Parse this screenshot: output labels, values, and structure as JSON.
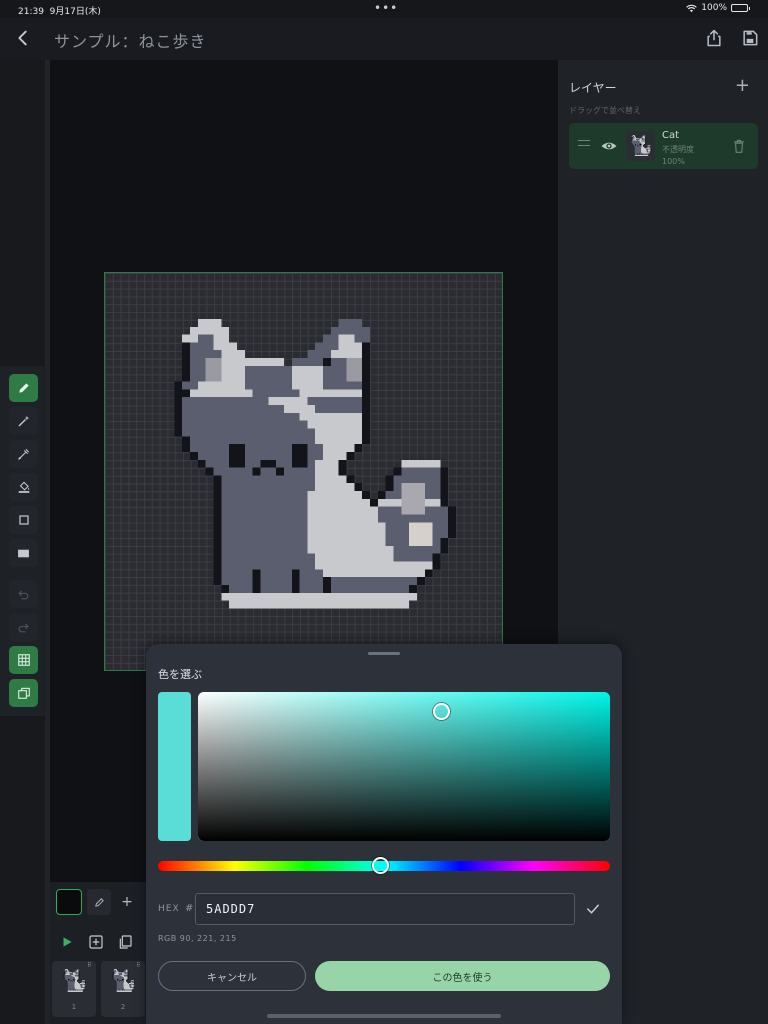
{
  "status": {
    "time": "21:39",
    "date": "9月17日(木)",
    "battery": "100%"
  },
  "header": {
    "title": "サンプル：ねこ歩き"
  },
  "layers_panel": {
    "title": "レイヤー",
    "hint": "ドラッグで並べ替え",
    "layers": [
      {
        "name": "Cat",
        "opacity_label": "不透明度",
        "opacity_value": "100%"
      }
    ]
  },
  "frames": [
    {
      "number": "1"
    },
    {
      "number": "2"
    }
  ],
  "color_picker": {
    "title": "色を選ぶ",
    "hex_label": "HEX",
    "hex_hash": "#",
    "hex_value": "5ADDD7",
    "rgb_text": "RGB  90, 221, 215",
    "cancel_label": "キャンセル",
    "use_label": "この色を使う",
    "selected_color": "#5ADDD7",
    "hue_color": "#00F5E8"
  },
  "colors": {
    "accent_green": "#2F7A45",
    "primary_button": "#97D4A8"
  }
}
